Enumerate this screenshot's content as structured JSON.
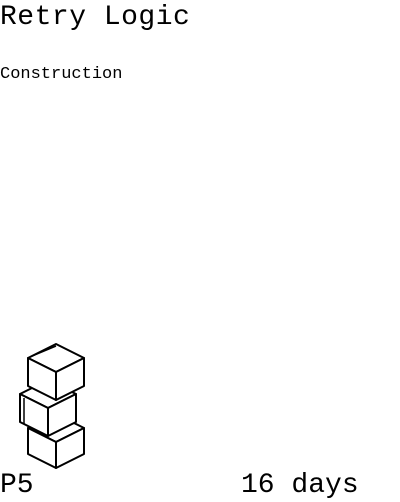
{
  "card": {
    "title": "Retry Logic",
    "category": "Construction",
    "code": "P5",
    "duration": "16 days",
    "icon": "stacked-blocks-icon",
    "ink_color": "#000000",
    "background_color": "#ffffff"
  }
}
